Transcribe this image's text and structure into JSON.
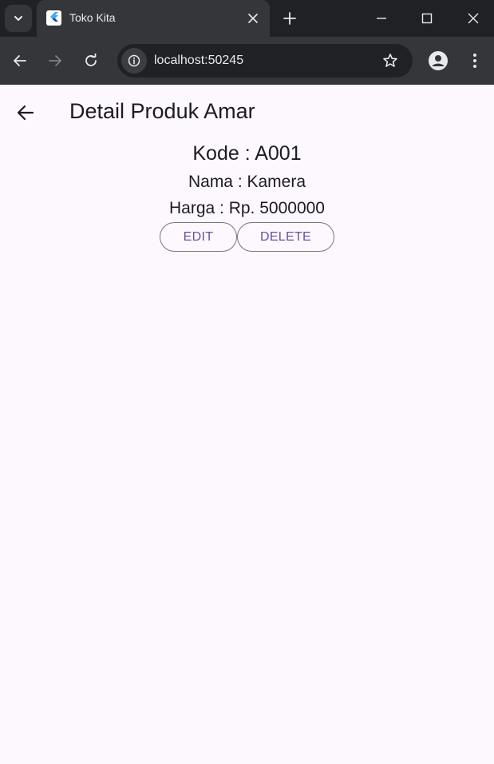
{
  "browser": {
    "tab_title": "Toko Kita",
    "url": "localhost:50245",
    "colors": {
      "tabstrip": "#202124",
      "toolbar": "#35363a",
      "favicon": "#42a5f5"
    }
  },
  "app": {
    "title": "Detail Produk Amar",
    "product": {
      "kode": "Kode : A001",
      "nama": "Nama : Kamera",
      "harga": "Harga : Rp. 5000000"
    },
    "buttons": {
      "edit": "EDIT",
      "delete": "DELETE"
    },
    "colors": {
      "background": "#fdf7fe",
      "primary": "#6750a4",
      "outline": "#79747e",
      "text": "#1d1b20"
    }
  },
  "icons": [
    "chevron-down-icon",
    "flutter-logo-icon",
    "close-icon",
    "plus-icon",
    "minimize-icon",
    "maximize-icon",
    "back-arrow-icon",
    "forward-arrow-icon",
    "reload-icon",
    "info-icon",
    "star-icon",
    "profile-icon",
    "more-vert-icon"
  ]
}
